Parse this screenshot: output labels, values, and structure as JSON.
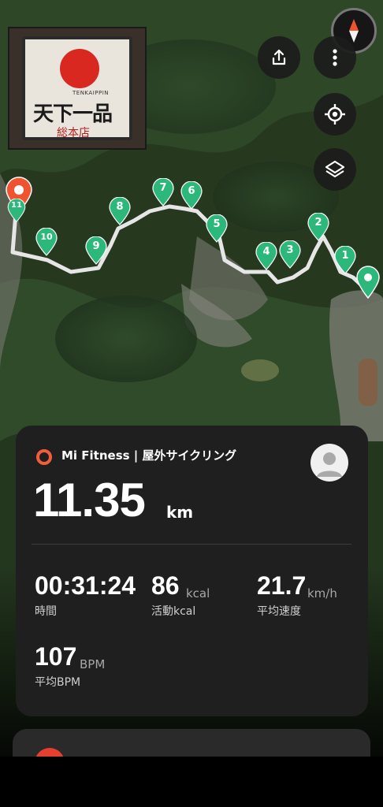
{
  "map": {
    "photo": {
      "sign_romaji": "TENKAIPPIN",
      "sign_kanji": "天下一品",
      "sign_branch": "総本店",
      "icon": "photo-thumbnail"
    },
    "buttons": {
      "compass": "compass-icon",
      "share": "share-icon",
      "more": "more-vertical-icon",
      "locate": "locate-icon",
      "layers": "layers-icon"
    },
    "markers": [
      {
        "label": "1"
      },
      {
        "label": "2"
      },
      {
        "label": "3"
      },
      {
        "label": "4"
      },
      {
        "label": "5"
      },
      {
        "label": "6"
      },
      {
        "label": "7"
      },
      {
        "label": "8"
      },
      {
        "label": "9"
      },
      {
        "label": "10"
      },
      {
        "label": "11"
      }
    ],
    "colors": {
      "route": "#e6e6e6",
      "marker_green": "#2cb87a",
      "end_pin": "#f0532f"
    }
  },
  "summary": {
    "app_name": "Mi Fitness | 屋外サイクリング",
    "distance": "11.35",
    "distance_unit": "km",
    "stats": {
      "time": {
        "value": "00:31:24",
        "label": "時間"
      },
      "calories": {
        "value": "86",
        "unit": "kcal",
        "label": "活動kcal"
      },
      "speed": {
        "value": "21.7",
        "unit": "km/h",
        "label": "平均速度"
      },
      "bpm": {
        "value": "107",
        "unit": "BPM",
        "label": "平均BPM"
      }
    },
    "accent_color": "#f25d3c"
  }
}
